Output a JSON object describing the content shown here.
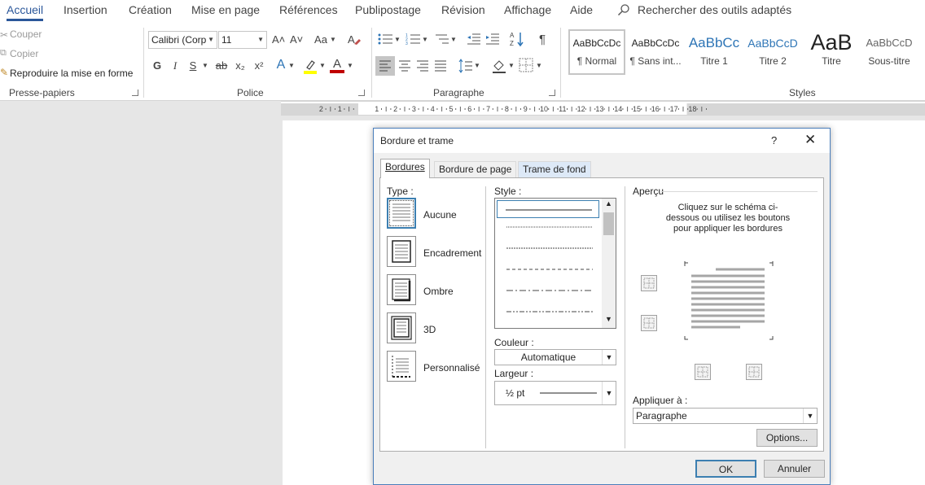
{
  "tabs": [
    "Accueil",
    "Insertion",
    "Création",
    "Mise en page",
    "Références",
    "Publipostage",
    "Révision",
    "Affichage",
    "Aide"
  ],
  "search": {
    "icon": "search-icon",
    "label": "Rechercher des outils adaptés"
  },
  "clipboard": {
    "cut": "Couper",
    "copy": "Copier",
    "format_painter": "Reproduire la mise en forme",
    "label": "Presse-papiers"
  },
  "font": {
    "name": "Calibri (Corp",
    "size": "11",
    "grow": "A˄",
    "shrink": "A˅",
    "case": "Aa",
    "bold": "G",
    "italic": "I",
    "underline": "S",
    "strike": "ab",
    "subscript": "x₂",
    "superscript": "x²",
    "text_effects": "A",
    "font_color": "A",
    "label": "Police"
  },
  "paragraph": {
    "label": "Paragraphe",
    "pilcrow": "¶"
  },
  "styles": {
    "label": "Styles",
    "items": [
      {
        "preview": "AaBbCcDc",
        "name": "¶ Normal"
      },
      {
        "preview": "AaBbCcDc",
        "name": "¶ Sans int..."
      },
      {
        "preview": "AaBbCc",
        "name": "Titre 1"
      },
      {
        "preview": "AaBbCcD",
        "name": "Titre 2"
      },
      {
        "preview": "AaB",
        "name": "Titre"
      },
      {
        "preview": "AaBbCcD",
        "name": "Sous-titre"
      }
    ]
  },
  "ruler": {
    "labels": [
      "2",
      "1",
      "1",
      "2",
      "3",
      "4",
      "5",
      "6",
      "7",
      "8",
      "9",
      "10",
      "11",
      "12",
      "13",
      "14",
      "15",
      "16",
      "17",
      "18"
    ]
  },
  "dialog": {
    "title": "Bordure et trame",
    "help": "?",
    "close": "✕",
    "tabs": [
      "Bordures",
      "Bordure de page",
      "Trame de fond"
    ],
    "type_label": "Type :",
    "types": [
      "Aucune",
      "Encadrement",
      "Ombre",
      "3D",
      "Personnalisé"
    ],
    "style_label": "Style :",
    "color_label": "Couleur :",
    "color_value": "Automatique",
    "width_label": "Largeur :",
    "width_value": "½ pt",
    "preview_label": "Aperçu",
    "preview_hint": "Cliquez sur le schéma ci-dessous ou utilisez les boutons pour appliquer les bordures",
    "apply_label": "Appliquer à :",
    "apply_value": "Paragraphe",
    "options_button": "Options...",
    "ok_button": "OK",
    "cancel_button": "Annuler"
  },
  "colors": {
    "accent": "#2b579a",
    "dialog_border": "#4a7ebb",
    "highlight": "#ffff00",
    "font_red": "#c00000"
  }
}
